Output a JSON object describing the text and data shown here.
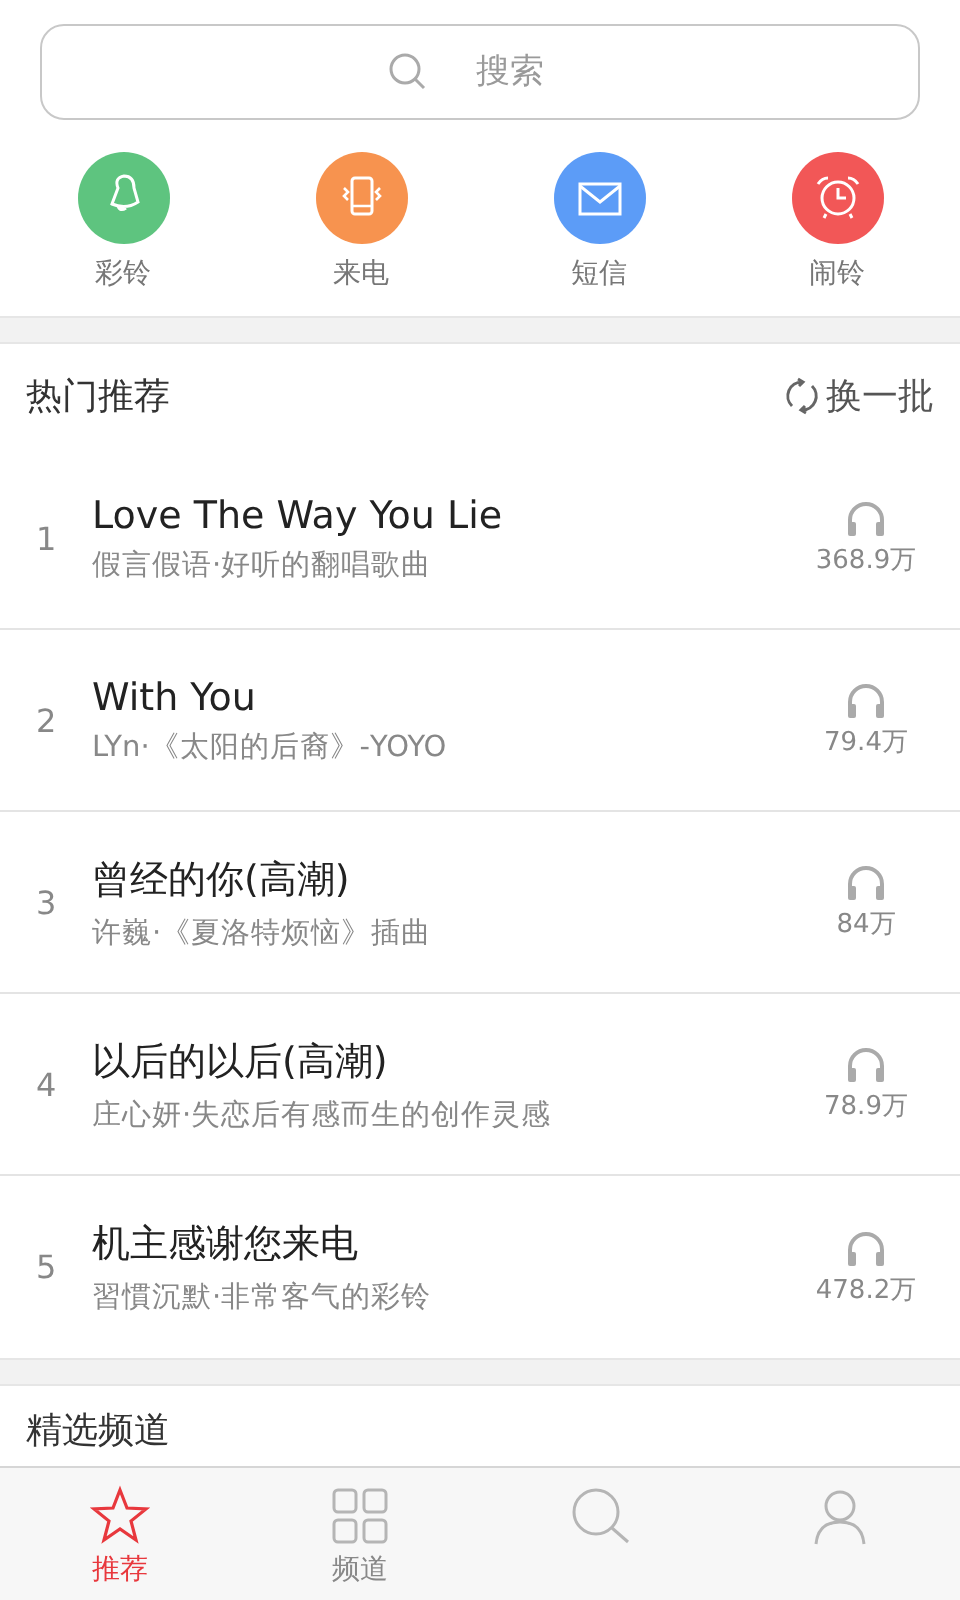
{
  "search": {
    "placeholder": "搜索"
  },
  "shortcuts": [
    {
      "kind": "bell",
      "label": "彩铃",
      "color": "#5ec47f"
    },
    {
      "kind": "phone",
      "label": "来电",
      "color": "#f7934f"
    },
    {
      "kind": "mail",
      "label": "短信",
      "color": "#5c9cf7"
    },
    {
      "kind": "alarm",
      "label": "闹铃",
      "color": "#f25757"
    }
  ],
  "hot": {
    "title": "热门推荐",
    "refresh": "换一批",
    "songs": [
      {
        "rank": "1",
        "title": "Love The Way You Lie",
        "subtitle": "假言假语·好听的翻唱歌曲",
        "plays": "368.9万"
      },
      {
        "rank": "2",
        "title": "With You",
        "subtitle": "LYn·《太阳的后裔》-YOYO",
        "plays": "79.4万"
      },
      {
        "rank": "3",
        "title": "曾经的你(高潮)",
        "subtitle": "许巍·《夏洛特烦恼》插曲",
        "plays": "84万"
      },
      {
        "rank": "4",
        "title": "以后的以后(高潮)",
        "subtitle": "庄心妍·失恋后有感而生的创作灵感",
        "plays": "78.9万"
      },
      {
        "rank": "5",
        "title": "机主感谢您来电",
        "subtitle": "習慣沉默·非常客气的彩铃",
        "plays": "478.2万"
      }
    ]
  },
  "channels": {
    "title": "精选频道"
  },
  "tabs": [
    {
      "kind": "star",
      "label": "推荐",
      "selected": true
    },
    {
      "kind": "grid",
      "label": "频道",
      "selected": false
    },
    {
      "kind": "search",
      "selected": false
    },
    {
      "kind": "person",
      "selected": false
    }
  ]
}
